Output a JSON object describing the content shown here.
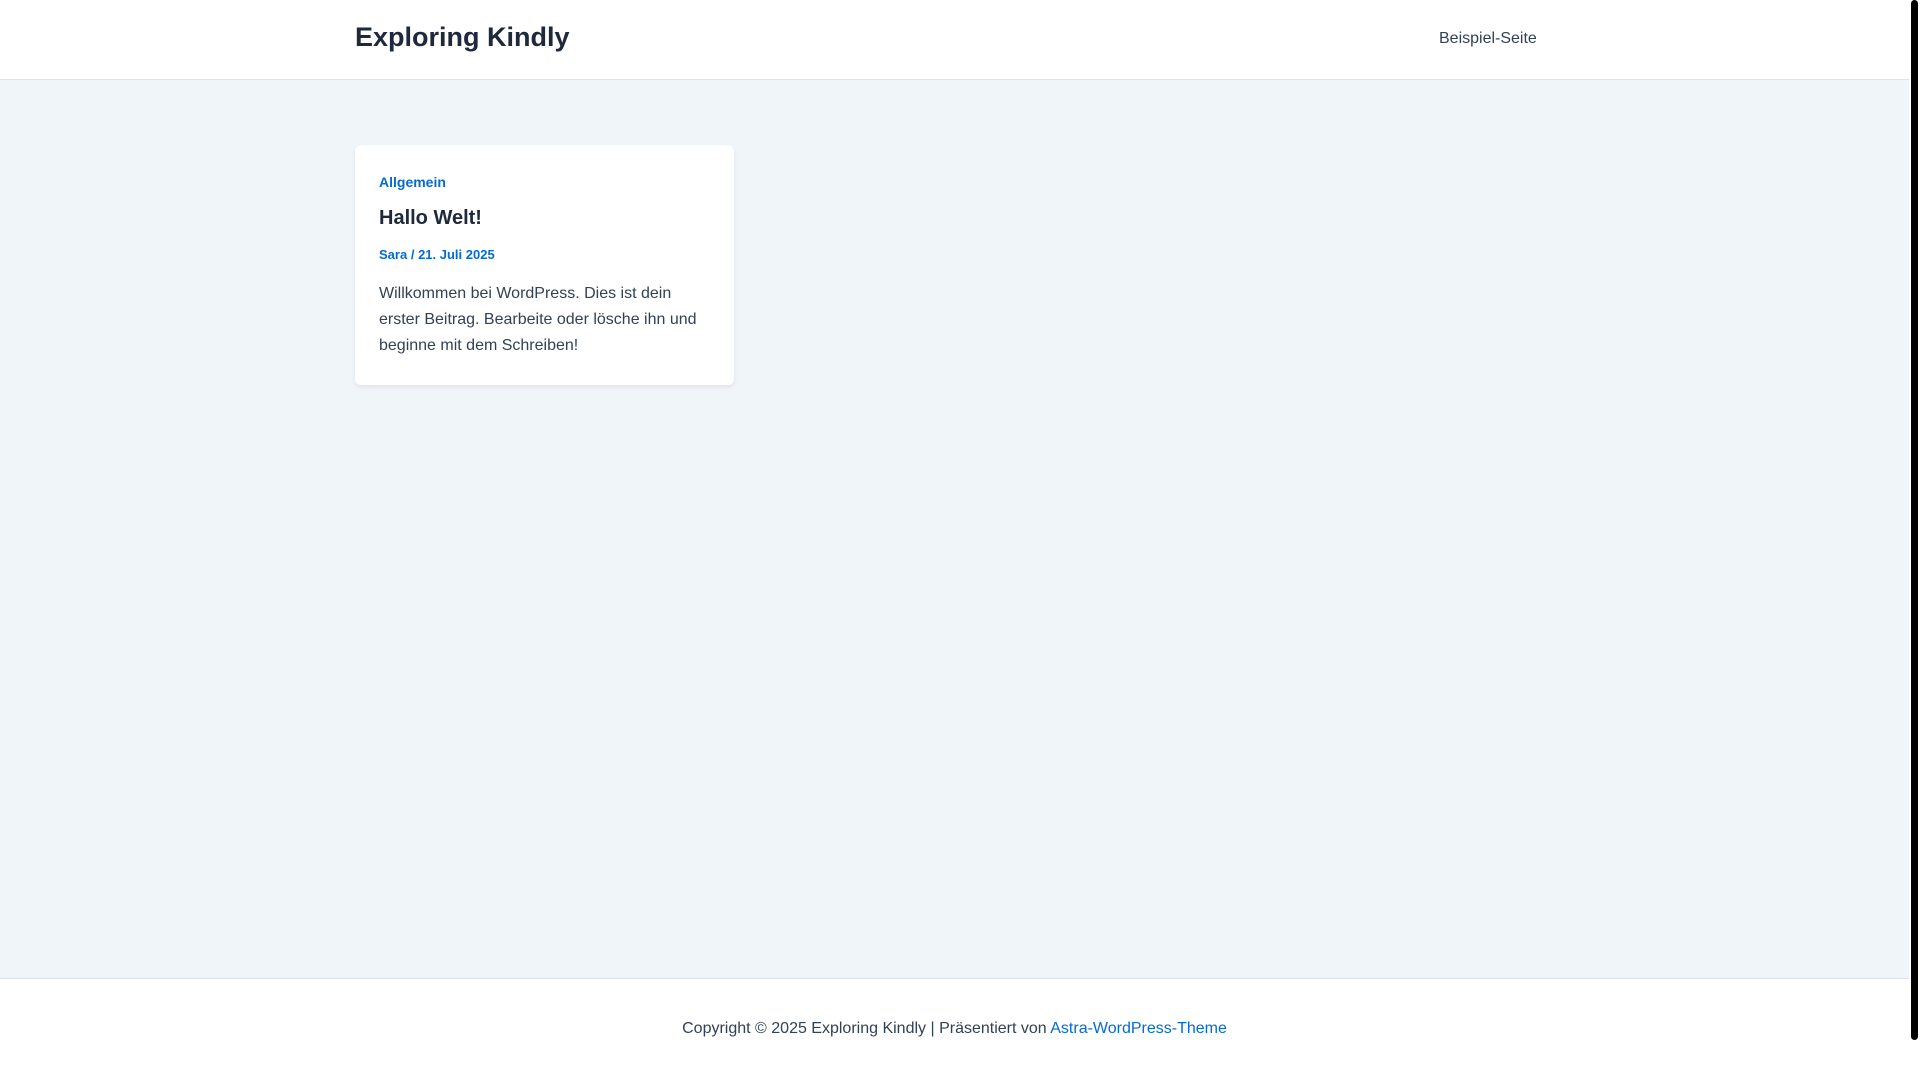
{
  "header": {
    "site_title": "Exploring Kindly",
    "nav": [
      {
        "label": "Beispiel-Seite"
      }
    ]
  },
  "post": {
    "category": "Allgemein",
    "title": "Hallo Welt!",
    "author": "Sara",
    "separator": "/",
    "date": "21. Juli 2025",
    "excerpt": "Willkommen bei WordPress. Dies ist dein erster Beitrag. Bearbeite oder lösche ihn und beginne mit dem Schreiben!"
  },
  "footer": {
    "copyright_text": "Copyright © 2025 Exploring Kindly | Präsentiert von",
    "theme_link": "Astra-WordPress-Theme"
  },
  "colors": {
    "accent": "#046bd2",
    "heading": "#1e293b",
    "body_text": "#334155",
    "background": "#f0f5fa"
  }
}
